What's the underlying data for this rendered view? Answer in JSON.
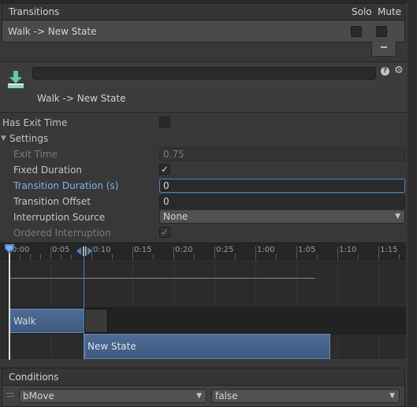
{
  "transitions": {
    "title": "Transitions",
    "solo_label": "Solo",
    "mute_label": "Mute",
    "rows": [
      {
        "label": "Walk -> New State",
        "solo": false,
        "mute": false
      }
    ],
    "remove_button": "−"
  },
  "inspector": {
    "title": "Walk -> New State",
    "name_field": ""
  },
  "properties": {
    "has_exit_time": {
      "label": "Has Exit Time",
      "checked": false
    },
    "settings": {
      "label": "Settings",
      "expanded": true
    },
    "exit_time": {
      "label": "Exit Time",
      "value": "0.75"
    },
    "fixed_duration": {
      "label": "Fixed Duration",
      "checked": true
    },
    "transition_duration": {
      "label": "Transition Duration (s)",
      "value": "0"
    },
    "transition_offset": {
      "label": "Transition Offset",
      "value": "0"
    },
    "interruption_source": {
      "label": "Interruption Source",
      "value": "None"
    },
    "ordered_interruption": {
      "label": "Ordered Interruption",
      "checked": true
    }
  },
  "timeline": {
    "ticks": [
      "0:00",
      "0:05",
      "0:10",
      "0:15",
      "0:20",
      "0:25",
      "1:00",
      "1:05",
      "1:10",
      "1:15"
    ],
    "source_state": "Walk",
    "destination_state": "New State"
  },
  "conditions": {
    "title": "Conditions",
    "items": [
      {
        "parameter": "bMove",
        "value": "false"
      }
    ]
  },
  "colors": {
    "accent": "#4b84c4",
    "state_bar": "#465f85",
    "background": "#383838"
  }
}
